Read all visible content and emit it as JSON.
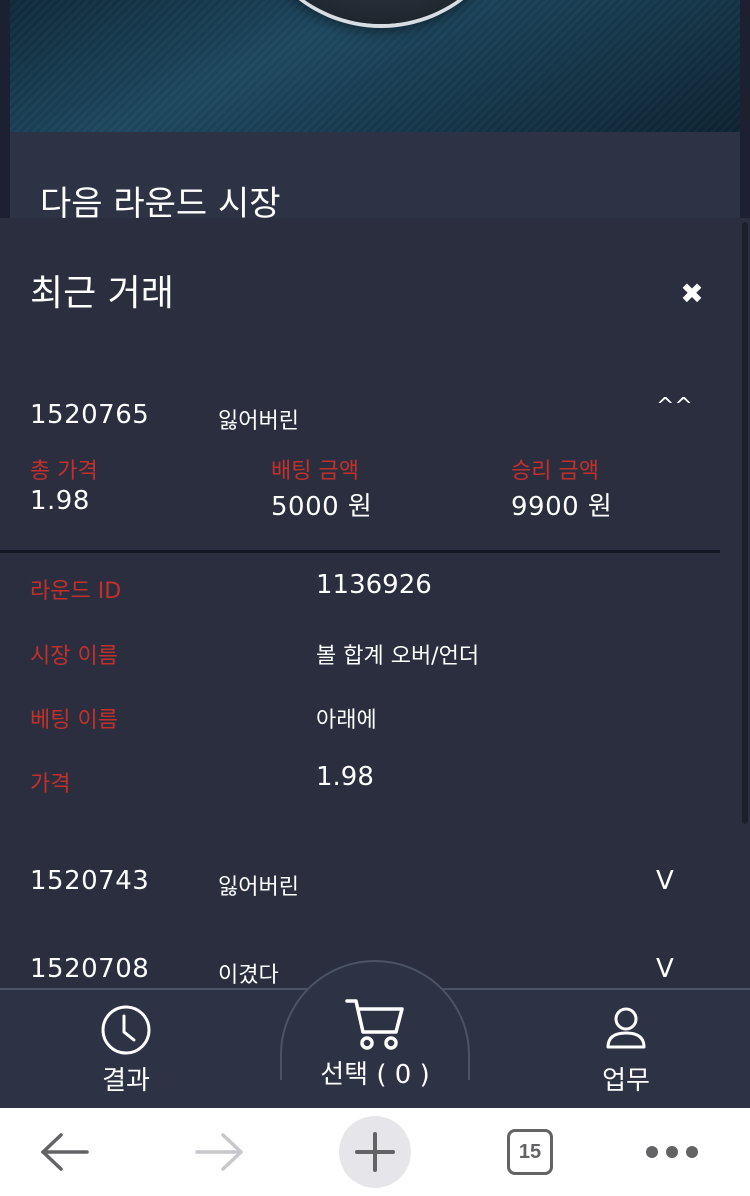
{
  "market": {
    "title": "다음 라운드 시장"
  },
  "panel": {
    "title": "최근 거래",
    "close_icon": "✖"
  },
  "trades": [
    {
      "id": "1520765",
      "status": "잃어버린",
      "toggle": "^^",
      "stats": [
        {
          "label": "총 가격",
          "value": "1.98"
        },
        {
          "label": "배팅 금액",
          "value": "5000 원"
        },
        {
          "label": "승리 금액",
          "value": "9900 원"
        }
      ],
      "details": [
        {
          "label": "라운드 ID",
          "value": "1136926"
        },
        {
          "label": "시장 이름",
          "value": "볼 합계 오버/언더"
        },
        {
          "label": "베팅 이름",
          "value": "아래에"
        },
        {
          "label": "가격",
          "value": "1.98"
        }
      ]
    },
    {
      "id": "1520743",
      "status": "잃어버린",
      "toggle": "V"
    },
    {
      "id": "1520708",
      "status": "이겼다",
      "toggle": "V"
    }
  ],
  "bottom_nav": {
    "results": {
      "label": "결과",
      "icon": "clock-icon"
    },
    "selection": {
      "label": "선택 ( 0 )",
      "icon": "cart-icon"
    },
    "account": {
      "label": "업무",
      "icon": "user-icon"
    }
  },
  "browser": {
    "tab_count": "15",
    "back_icon": "back-arrow-icon",
    "forward_icon": "forward-arrow-icon",
    "new_tab_icon": "plus-icon",
    "more_icon": "more-icon"
  },
  "colors": {
    "panel_bg": "#2a2e3f",
    "label_red": "#c3302b",
    "text_white": "#ffffff"
  }
}
